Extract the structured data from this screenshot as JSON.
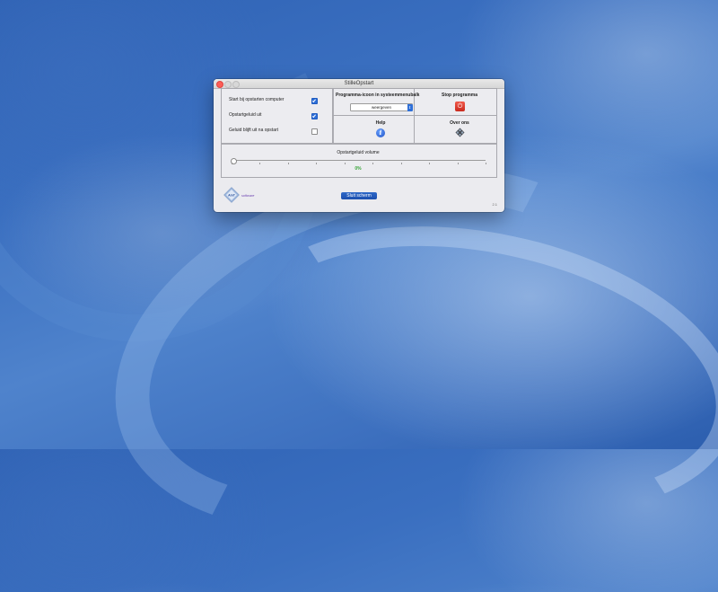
{
  "window": {
    "title": "StilleOpstart"
  },
  "options": [
    {
      "label": "Start bij opstarten computer",
      "checked": true
    },
    {
      "label": "Opstartgeluid uit",
      "checked": true
    },
    {
      "label": "Geluid blijft uit na opstart",
      "checked": false
    }
  ],
  "menubar_icon": {
    "title": "Programma-icoon in systeemmenubalk",
    "selected": "weergeven"
  },
  "stop": {
    "title": "Stop programma",
    "icon": "power-icon",
    "color": "#e0392b"
  },
  "help": {
    "title": "Help",
    "icon": "info-icon",
    "color": "#2a62d6"
  },
  "about": {
    "title": "Over ons",
    "icon": "about-icon"
  },
  "volume": {
    "title": "Opstartgeluid volume",
    "value_text": "0%",
    "value": 0,
    "tick_count": 10,
    "value_color": "#3aa53a"
  },
  "logo": {
    "text": "AmT",
    "suffix": "software"
  },
  "close_button": {
    "label": "Sluit scherm"
  },
  "version": {
    "text": "2.1"
  },
  "colors": {
    "accent": "#1f5bbf",
    "desktop": "#3a6fc0"
  }
}
